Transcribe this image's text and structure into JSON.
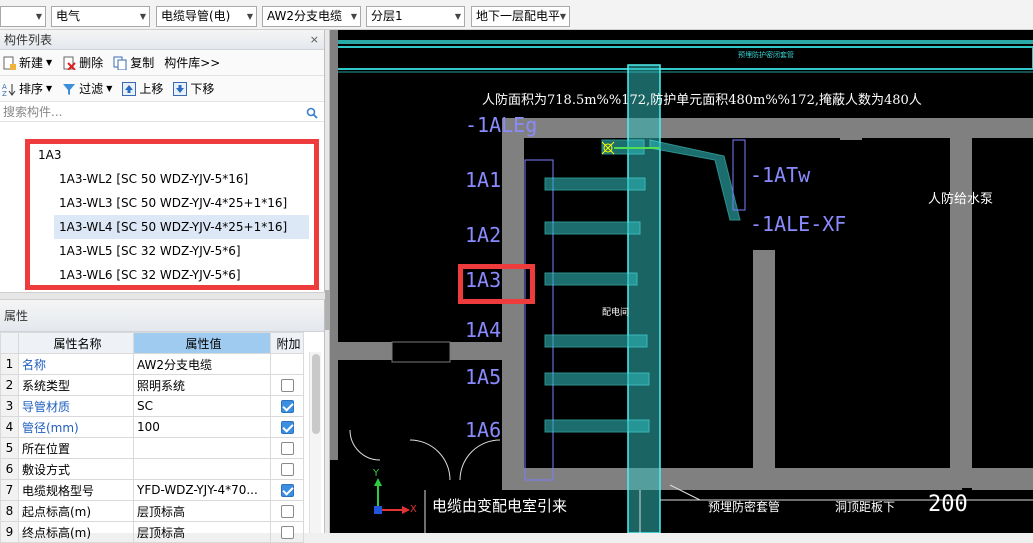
{
  "toolbar": {
    "combos": [
      {
        "value": ""
      },
      {
        "value": "电气"
      },
      {
        "value": "电缆导管(电)"
      },
      {
        "value": "AW2分支电缆"
      },
      {
        "value": "分层1"
      },
      {
        "value": "地下一层配电平"
      }
    ]
  },
  "component_list": {
    "title": "构件列表",
    "actions": {
      "new": "新建",
      "delete": "删除",
      "copy": "复制",
      "library": "构件库>>",
      "sort": "排序",
      "filter": "过滤",
      "move_up": "上移",
      "move_down": "下移"
    },
    "search_placeholder": "搜索构件...",
    "tree_root": "1A3",
    "tree_items": [
      "1A3-WL2 [SC 50 WDZ-YJV-5*16]",
      "1A3-WL3 [SC 50 WDZ-YJV-4*25+1*16]",
      "1A3-WL4 [SC 50 WDZ-YJV-4*25+1*16]",
      "1A3-WL5 [SC 32 WDZ-YJV-5*6]",
      "1A3-WL6 [SC 32 WDZ-YJV-5*6]"
    ],
    "selected_index": 2
  },
  "properties": {
    "title": "属性",
    "headers": {
      "name": "属性名称",
      "value": "属性值",
      "extra": "附加"
    },
    "rows": [
      {
        "idx": "1",
        "name": "名称",
        "value": "AW2分支电缆",
        "blue": true,
        "check": null
      },
      {
        "idx": "2",
        "name": "系统类型",
        "value": "照明系统",
        "blue": false,
        "check": false
      },
      {
        "idx": "3",
        "name": "导管材质",
        "value": "SC",
        "blue": true,
        "check": true
      },
      {
        "idx": "4",
        "name": "管径(mm)",
        "value": "100",
        "blue": true,
        "check": true
      },
      {
        "idx": "5",
        "name": "所在位置",
        "value": "",
        "blue": false,
        "check": false
      },
      {
        "idx": "6",
        "name": "敷设方式",
        "value": "",
        "blue": false,
        "check": false
      },
      {
        "idx": "7",
        "name": "电缆规格型号",
        "value": "YFD-WDZ-YJY-4*70...",
        "blue": false,
        "check": true
      },
      {
        "idx": "8",
        "name": "起点标高(m)",
        "value": "层顶标高",
        "blue": false,
        "check": false
      },
      {
        "idx": "9",
        "name": "终点标高(m)",
        "value": "层顶标高",
        "blue": false,
        "check": false
      }
    ]
  },
  "drawing": {
    "top_note": "人防面积为718.5m%%172,防护单元面积480m%%172,掩蔽人数为480人",
    "top_small": "预埋防护密闭套管",
    "label_ale": "-1ALEg",
    "panels": [
      "1A1",
      "1A2",
      "1A3",
      "1A4",
      "1A5",
      "1A6"
    ],
    "right_labels": [
      "-1ATw",
      "-1ALE-XF"
    ],
    "room_label": "配电间",
    "pump_label": "人防给水泵",
    "bottom_left": "电缆由变配电室引来",
    "bottom_mid": "预埋防密套管",
    "bottom_right": "洞顶距板下",
    "bottom_num": "200",
    "axis_y": "Y",
    "axis_x": "X",
    "colors": {
      "wall": "#808080",
      "cable": "#39d6d6",
      "text": "#ffffff",
      "panel_text": "#8a8aff"
    }
  }
}
